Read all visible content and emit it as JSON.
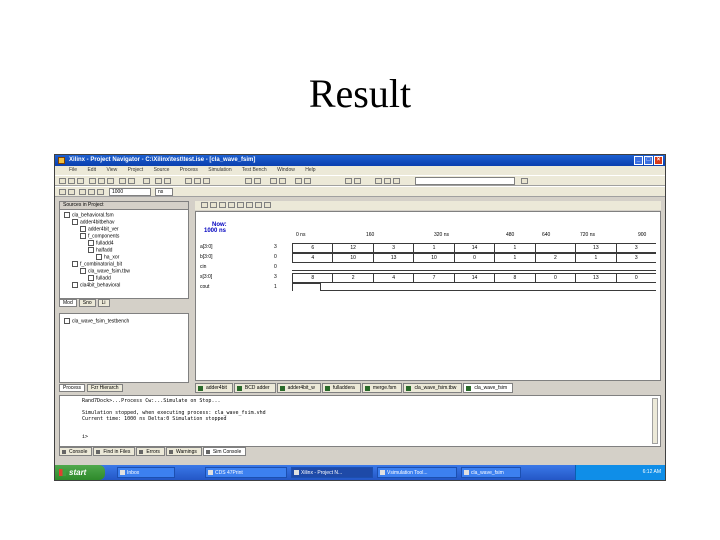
{
  "slide": {
    "title": "Result"
  },
  "window": {
    "title": "Xilinx - Project Navigator - C:\\Xilinx\\test\\test.ise - [cla_wave_fsim]",
    "menu": [
      "File",
      "Edit",
      "View",
      "Project",
      "Source",
      "Process",
      "Simulation",
      "Test Bench",
      "Window",
      "Help"
    ]
  },
  "toolbar": {
    "sim_time": "1000",
    "sim_unit": "ns"
  },
  "sources": {
    "header": "Sources in Project",
    "items": [
      "cla_behavioral.fsm",
      "adder4bitbehav",
      "adder4bit_ver",
      "f_components",
      "fulladd4",
      "halfadd",
      "ha_xor",
      "f_combinatorial_bit",
      "cla_wave_fsim.tbw",
      "fulladd",
      "cla4bit_behavioral"
    ],
    "tabs": [
      "Mod",
      "Sno",
      "Li"
    ]
  },
  "process_pane": {
    "item": "cla_wave_fsim_testbench",
    "tabs": [
      "Process",
      "Fzr Hierarch"
    ]
  },
  "wave": {
    "now_label": "Now:",
    "now_value": "1000 ns",
    "ticks": [
      "0 ns",
      "160",
      "320 ns",
      "480",
      "640",
      "720 ns",
      "900"
    ],
    "signals": [
      {
        "name": "a[3:0]",
        "value": "3"
      },
      {
        "name": "b[3:0]",
        "value": "0"
      },
      {
        "name": "cin",
        "value": "0"
      },
      {
        "name": "s[3:0]",
        "value": "3"
      },
      {
        "name": "cout",
        "value": "1"
      }
    ],
    "bus_a": [
      "6",
      "12",
      "3",
      "1",
      "14",
      "1",
      "",
      "13",
      "3"
    ],
    "bus_b": [
      "4",
      "10",
      "13",
      "10",
      "0",
      "1",
      "2",
      "1",
      "3"
    ],
    "bus_s": [
      "8",
      "2",
      "4",
      "7",
      "14",
      "8",
      "0",
      "13",
      "0"
    ],
    "tabs": [
      "adder4bit",
      "BCD adder",
      "adder4bit_w",
      "fulladdera",
      "merge.fsm",
      "cla_wave_fsim.tbw",
      "cla_wave_fsim"
    ]
  },
  "console": {
    "lines": [
      "Rand7Dock>...Process Cw:...Simulate on Stop...",
      "",
      "Simulation stopped, when executing process: cla_wave_fsim.vhd",
      "Current time: 1000 ns  Delta:0  Simulation stopped",
      "",
      "",
      "i>"
    ],
    "tabs": [
      "Console",
      "Find in Files",
      "Errors",
      "Warnings",
      "Sim Console"
    ]
  },
  "taskbar": {
    "start_label": "start",
    "buttons": [
      "Inbox",
      "CDS 47Print",
      "Xilinx - Project N...",
      "Vsimulation Tool...",
      "cla_wave_fsim"
    ],
    "clock": "6:12 AM"
  }
}
